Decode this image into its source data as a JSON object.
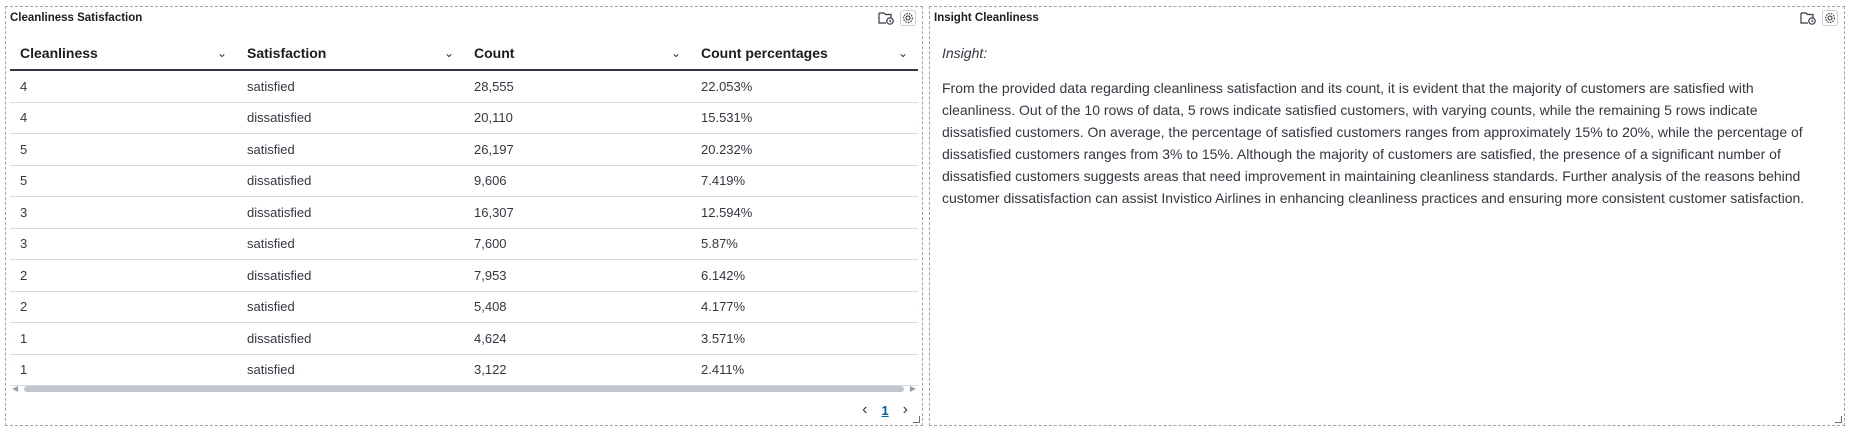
{
  "left_panel": {
    "title": "Cleanliness Satisfaction",
    "columns": [
      "Cleanliness",
      "Satisfaction",
      "Count",
      "Count percentages"
    ],
    "rows": [
      [
        "4",
        "satisfied",
        "28,555",
        "22.053%"
      ],
      [
        "4",
        "dissatisfied",
        "20,110",
        "15.531%"
      ],
      [
        "5",
        "satisfied",
        "26,197",
        "20.232%"
      ],
      [
        "5",
        "dissatisfied",
        "9,606",
        "7.419%"
      ],
      [
        "3",
        "dissatisfied",
        "16,307",
        "12.594%"
      ],
      [
        "3",
        "satisfied",
        "7,600",
        "5.87%"
      ],
      [
        "2",
        "dissatisfied",
        "7,953",
        "6.142%"
      ],
      [
        "2",
        "satisfied",
        "5,408",
        "4.177%"
      ],
      [
        "1",
        "dissatisfied",
        "4,624",
        "3.571%"
      ],
      [
        "1",
        "satisfied",
        "3,122",
        "2.411%"
      ]
    ],
    "pagination": {
      "current_page": "1"
    }
  },
  "right_panel": {
    "title": "Insight Cleanliness",
    "heading": "Insight:",
    "body": "From the provided data regarding cleanliness satisfaction and its count, it is evident that the majority of customers are satisfied with cleanliness. Out of the 10 rows of data, 5 rows indicate satisfied customers, with varying counts, while the remaining 5 rows indicate dissatisfied customers. On average, the percentage of satisfied customers ranges from approximately 15% to 20%, while the percentage of dissatisfied customers ranges from 3% to 15%. Although the majority of customers are satisfied, the presence of a significant number of dissatisfied customers suggests areas that need improvement in maintaining cleanliness standards. Further analysis of the reasons behind customer dissatisfaction can assist Invistico Airlines in enhancing cleanliness practices and ensuring more consistent customer satisfaction."
  },
  "icons": {
    "panel_tools": [
      "folder-clock-icon",
      "gear-icon"
    ],
    "column_menu": "chevron-down-icon"
  },
  "colors": {
    "link": "#0061a6",
    "border": "#98a2b3",
    "text": "#343741"
  }
}
